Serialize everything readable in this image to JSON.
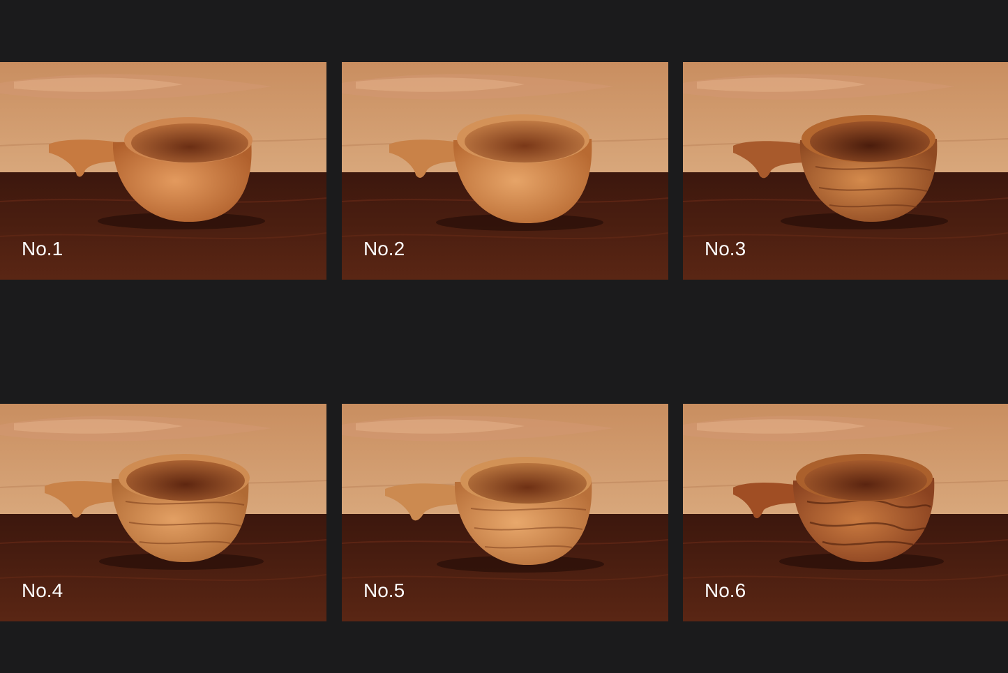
{
  "gallery": {
    "items": [
      {
        "label": "No.1"
      },
      {
        "label": "No.2"
      },
      {
        "label": "No.3"
      },
      {
        "label": "No.4"
      },
      {
        "label": "No.5"
      },
      {
        "label": "No.6"
      }
    ]
  },
  "colors": {
    "background": "#1b1b1c",
    "backboard": "#c88f62",
    "table": "#4a1f12",
    "cup_light": "#d8925a",
    "cup_dark": "#8a4a26",
    "label": "#ffffff"
  }
}
